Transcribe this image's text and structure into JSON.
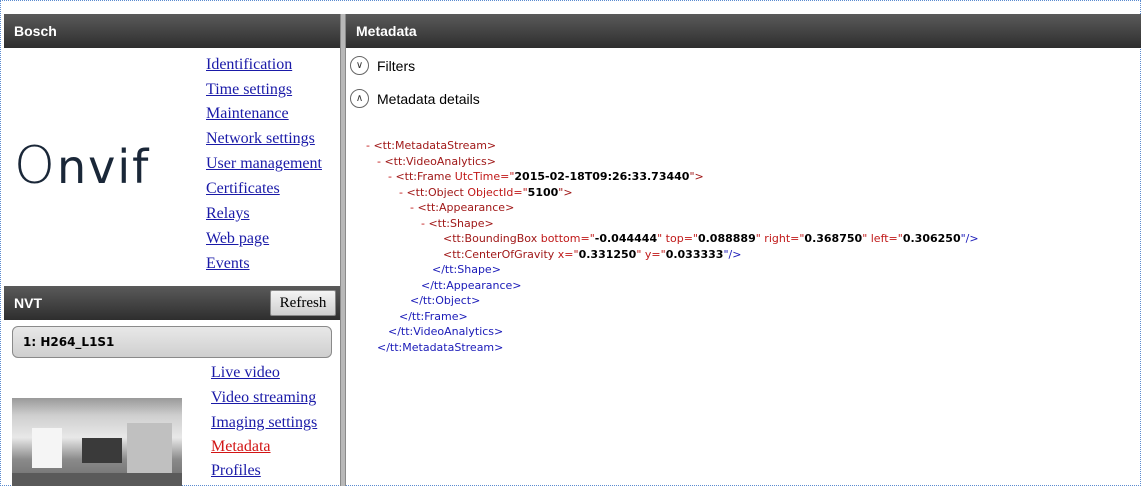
{
  "left": {
    "header_title": "Bosch",
    "logo_text": "Onvif",
    "nav_items": [
      {
        "label": "Identification"
      },
      {
        "label": "Time settings"
      },
      {
        "label": "Maintenance"
      },
      {
        "label": "Network settings"
      },
      {
        "label": "User management"
      },
      {
        "label": "Certificates"
      },
      {
        "label": "Relays"
      },
      {
        "label": "Web page"
      },
      {
        "label": "Events"
      }
    ],
    "nvt_title": "NVT",
    "refresh_label": "Refresh",
    "profile_label": "1: H264_L1S1",
    "nvt_items": [
      {
        "label": "Live video"
      },
      {
        "label": "Video streaming"
      },
      {
        "label": "Imaging settings"
      },
      {
        "label": "Metadata",
        "active": true
      },
      {
        "label": "Profiles"
      }
    ]
  },
  "main": {
    "header_title": "Metadata",
    "filters_label": "Filters",
    "details_label": "Metadata details",
    "xml": {
      "l1": "<tt:MetadataStream>",
      "l2": "<tt:VideoAnalytics>",
      "l3_tag": "<tt:Frame ",
      "l3_attr": "UtcTime=\"",
      "l3_val": "2015-02-18T09:26:33.73440",
      "l3_end": "\">",
      "l4_tag": "<tt:Object ",
      "l4_attr": "ObjectId=\"",
      "l4_val": "5100",
      "l4_end": "\">",
      "l5": "<tt:Appearance>",
      "l6": "<tt:Shape>",
      "l7_tag": "<tt:BoundingBox ",
      "l7_a1": "bottom=\"",
      "l7_v1": "-0.044444",
      "l7_a2": "\" top=\"",
      "l7_v2": "0.088889",
      "l7_a3": "\" right=\"",
      "l7_v3": "0.368750",
      "l7_a4": "\" left=\"",
      "l7_v4": "0.306250",
      "l7_end": "\"/>",
      "l8_tag": "<tt:CenterOfGravity ",
      "l8_a1": "x=\"",
      "l8_v1": "0.331250",
      "l8_a2": "\" y=\"",
      "l8_v2": "0.033333",
      "l8_end": "\"/>",
      "l9": "</tt:Shape>",
      "l10": "</tt:Appearance>",
      "l11": "</tt:Object>",
      "l12": "</tt:Frame>",
      "l13": "</tt:VideoAnalytics>",
      "l14": "</tt:MetadataStream>"
    }
  },
  "colors": {
    "header_bg": "#3c3c3c",
    "link": "#1a1aa8",
    "link_active": "#d21414",
    "xml_tag": "#a01818",
    "xml_close": "#1a1ab8"
  }
}
